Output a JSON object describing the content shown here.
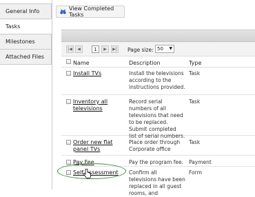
{
  "sidebar": {
    "tabs": [
      {
        "label": "General Info"
      },
      {
        "label": "Tasks"
      },
      {
        "label": "Milestones"
      },
      {
        "label": "Attached Files"
      }
    ]
  },
  "toolbar": {
    "view_completed_label": "View Completed Tasks"
  },
  "pager": {
    "current_page": "1",
    "page_size_label": "Page size:",
    "page_size_value": "50"
  },
  "table": {
    "headers": {
      "name": "Name",
      "description": "Description",
      "type": "Type"
    },
    "rows": [
      {
        "name": "Install TVs",
        "description": "Install the televisions according to the instructions provided.",
        "type": "Task"
      },
      {
        "name": "Inventory all televisions",
        "description": "Record serial numbers of all televisions that need to be replaced. Submit completed list of serial numbers.",
        "type": "Task"
      },
      {
        "name": "Order new flat panel TVs",
        "description": "Place order through Corporate office",
        "type": "Task"
      },
      {
        "name": "Pay Fee",
        "description": "Pay the program fee.",
        "type": "Payment"
      },
      {
        "name": "Self Assessment",
        "description": "Confirm all televisions have been replaced in all guest rooms, and",
        "type": "Form"
      }
    ]
  },
  "colors": {
    "highlight_oval": "#3b8a3b"
  }
}
